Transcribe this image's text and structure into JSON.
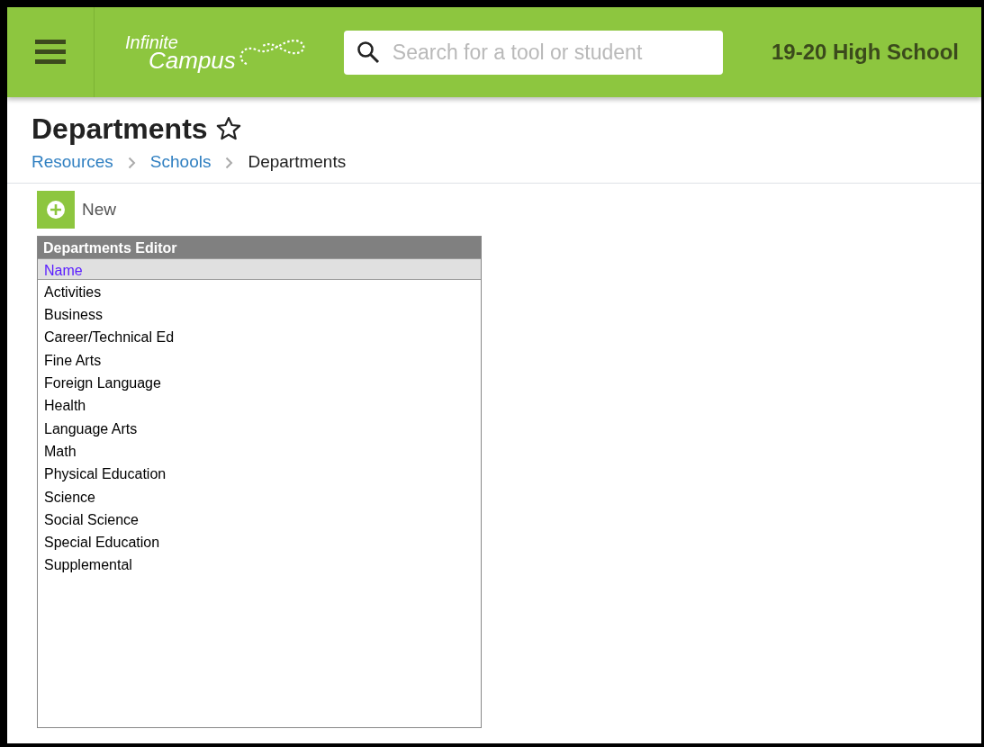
{
  "header": {
    "logo": {
      "line1": "Infinite",
      "line2": "Campus"
    },
    "search": {
      "placeholder": "Search for a tool or student"
    },
    "school": "19-20 High School"
  },
  "page": {
    "title": "Departments",
    "favorite": false,
    "breadcrumb": [
      {
        "label": "Resources",
        "link": true
      },
      {
        "label": "Schools",
        "link": true
      },
      {
        "label": "Departments",
        "link": false
      }
    ]
  },
  "toolbar": {
    "new_button": "New"
  },
  "editor": {
    "title": "Departments Editor",
    "column": "Name",
    "rows": [
      "Activities",
      "Business",
      "Career/Technical Ed",
      "Fine Arts",
      "Foreign Language",
      "Health",
      "Language Arts",
      "Math",
      "Physical Education",
      "Science",
      "Social Science",
      "Special Education",
      "Supplemental"
    ]
  }
}
